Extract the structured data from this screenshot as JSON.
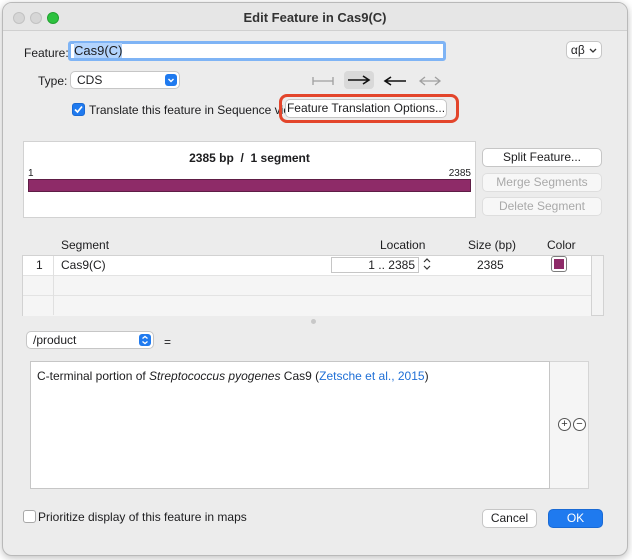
{
  "window": {
    "title": "Edit Feature in Cas9(C)"
  },
  "feature": {
    "label": "Feature:",
    "name": "Cas9(C)",
    "charset_button": "αβ",
    "type_label": "Type:",
    "type_value": "CDS",
    "direction_options": [
      "none",
      "forward",
      "reverse",
      "bidirectional"
    ],
    "selected_direction": "forward"
  },
  "translate": {
    "checked": true,
    "label": "Translate this feature in Sequence view",
    "options_button": "Feature Translation Options..."
  },
  "map": {
    "length_text": "2385 bp",
    "separator": "/",
    "segments_text": "1 segment",
    "start_label": "1",
    "end_label": "2385",
    "bar_color": "#8e2b68"
  },
  "segment_buttons": {
    "split": "Split Feature...",
    "merge": "Merge Segments",
    "delete": "Delete Segment"
  },
  "table": {
    "headers": {
      "segment": "Segment",
      "location": "Location",
      "size": "Size (bp)",
      "color": "Color"
    },
    "rows": [
      {
        "index": "1",
        "segment": "Cas9(C)",
        "start": "1",
        "range_sep": "..",
        "end": "2385",
        "size": "2385",
        "color": "#8e2b68"
      }
    ]
  },
  "qualifier": {
    "selected": "/product",
    "equals": "=",
    "text_before": "C-terminal portion of ",
    "text_italic": "Streptococcus pyogenes",
    "text_after": " Cas9 (",
    "link_text": "Zetsche et al., 2015",
    "text_close": ")",
    "add_symbol": "+",
    "remove_symbol": "−"
  },
  "footer": {
    "prioritize_checked": false,
    "prioritize_label": "Prioritize display of this feature in maps",
    "cancel": "Cancel",
    "ok": "OK"
  },
  "colors": {
    "accent": "#1f7aef",
    "highlight_ring": "#e3452b",
    "feature": "#8e2b68",
    "link": "#1f6fd6"
  }
}
